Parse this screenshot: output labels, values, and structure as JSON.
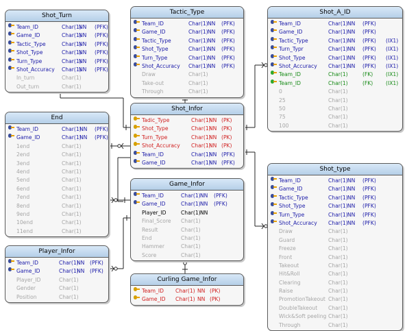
{
  "entities": [
    {
      "id": "shot-turn",
      "title": "Shot_Turn",
      "attrs": [
        {
          "name": "Team_ID",
          "type": "Char(1)",
          "nn": "NN",
          "key": "(PFK)",
          "style": "pk",
          "icon": true
        },
        {
          "name": "Game_ID",
          "type": "Char(1)",
          "nn": "NN",
          "key": "(PFK)",
          "style": "pk",
          "icon": true
        },
        {
          "name": "Tactic_Type",
          "type": "Char(1)",
          "nn": "NN",
          "key": "(PFK)",
          "style": "pk",
          "icon": true
        },
        {
          "name": "Shot_Type",
          "type": "Char(1)",
          "nn": "NN",
          "key": "(PFK)",
          "style": "pk",
          "icon": true
        },
        {
          "name": "Turn_Type",
          "type": "Char(1)",
          "nn": "NN",
          "key": "(PFK)",
          "style": "pk",
          "icon": true
        },
        {
          "name": "Shot_Accuracy",
          "type": "Char(1)",
          "nn": "NN",
          "key": "(PFK)",
          "style": "pk",
          "icon": true
        },
        {
          "name": "In_turn",
          "type": "Char(1)",
          "nn": "",
          "key": "",
          "style": "gray",
          "icon": false
        },
        {
          "name": "Out_turn",
          "type": "Char(1)",
          "nn": "",
          "key": "",
          "style": "gray",
          "icon": false
        }
      ]
    },
    {
      "id": "tactic-type",
      "title": "Tactic_Type",
      "attrs": [
        {
          "name": "Team_ID",
          "type": "Char(1)",
          "nn": "NN",
          "key": "(PFK)",
          "style": "pk",
          "icon": true
        },
        {
          "name": "Game_ID",
          "type": "Char(1)",
          "nn": "NN",
          "key": "(PFK)",
          "style": "pk",
          "icon": true
        },
        {
          "name": "Tactic_Type",
          "type": "Char(1)",
          "nn": "NN",
          "key": "(PFK)",
          "style": "pk",
          "icon": true
        },
        {
          "name": "Shot_Type",
          "type": "Char(1)",
          "nn": "NN",
          "key": "(PFK)",
          "style": "pk",
          "icon": true
        },
        {
          "name": "Turn_Type",
          "type": "Char(1)",
          "nn": "NN",
          "key": "(PFK)",
          "style": "pk",
          "icon": true
        },
        {
          "name": "Shot_Accuracy",
          "type": "Char(1)",
          "nn": "NN",
          "key": "(PFK)",
          "style": "pk",
          "icon": true
        },
        {
          "name": "Draw",
          "type": "Char(1)",
          "nn": "",
          "key": "",
          "style": "gray",
          "icon": false
        },
        {
          "name": "Take-out",
          "type": "Char(1)",
          "nn": "",
          "key": "",
          "style": "gray",
          "icon": false
        },
        {
          "name": "Through",
          "type": "Char(1)",
          "nn": "",
          "key": "",
          "style": "gray",
          "icon": false
        }
      ]
    },
    {
      "id": "shot-a-id",
      "title": "Shot_A_ID",
      "attrs": [
        {
          "name": "Team_ID",
          "type": "Char(1)",
          "nn": "NN",
          "key": "(PFK)",
          "ix": "",
          "style": "pk",
          "icon": true
        },
        {
          "name": "Game_ID",
          "type": "Char(1)",
          "nn": "NN",
          "key": "(PFK)",
          "ix": "",
          "style": "pk",
          "icon": true
        },
        {
          "name": "Tactic_Type",
          "type": "Char(1)",
          "nn": "NN",
          "key": "(PFK)",
          "ix": "(IX1)",
          "style": "pk",
          "icon": true
        },
        {
          "name": "Turn_Typr",
          "type": "Char(1)",
          "nn": "NN",
          "key": "(PFK)",
          "ix": "(IX1)",
          "style": "pk",
          "icon": true
        },
        {
          "name": "Shot_Type",
          "type": "Char(1)",
          "nn": "NN",
          "key": "(PFK)",
          "ix": "(IX1)",
          "style": "pk",
          "icon": true
        },
        {
          "name": "Shot_Accuracy",
          "type": "Char(1)",
          "nn": "NN",
          "key": "(PFK)",
          "ix": "(IX1)",
          "style": "pk",
          "icon": true
        },
        {
          "name": "Team_ID",
          "type": "Char(1)",
          "nn": "",
          "key": "(FK)",
          "ix": "(IX1)",
          "style": "green",
          "icon": true
        },
        {
          "name": "Team_ID",
          "type": "Char(1)",
          "nn": "",
          "key": "(FK)",
          "ix": "(IX1)",
          "style": "green",
          "icon": true
        },
        {
          "name": "0",
          "type": "Char(1)",
          "nn": "",
          "key": "",
          "ix": "",
          "style": "gray",
          "icon": false
        },
        {
          "name": "25",
          "type": "Char(1)",
          "nn": "",
          "key": "",
          "ix": "",
          "style": "gray",
          "icon": false
        },
        {
          "name": "50",
          "type": "Char(1)",
          "nn": "",
          "key": "",
          "ix": "",
          "style": "gray",
          "icon": false
        },
        {
          "name": "75",
          "type": "Char(1)",
          "nn": "",
          "key": "",
          "ix": "",
          "style": "gray",
          "icon": false
        },
        {
          "name": "100",
          "type": "Char(1)",
          "nn": "",
          "key": "",
          "ix": "",
          "style": "gray",
          "icon": false
        }
      ]
    },
    {
      "id": "end",
      "title": "End",
      "attrs": [
        {
          "name": "Team_ID",
          "type": "Char(1)",
          "nn": "NN",
          "key": "(PFK)",
          "style": "pk",
          "icon": true
        },
        {
          "name": "Game_ID",
          "type": "Char(1)",
          "nn": "NN",
          "key": "(PFK)",
          "style": "pk",
          "icon": true
        },
        {
          "name": "1end",
          "type": "Char(1)",
          "nn": "",
          "key": "",
          "style": "gray",
          "icon": false
        },
        {
          "name": "2end",
          "type": "Char(1)",
          "nn": "",
          "key": "",
          "style": "gray",
          "icon": false
        },
        {
          "name": "3end",
          "type": "Char(1)",
          "nn": "",
          "key": "",
          "style": "gray",
          "icon": false
        },
        {
          "name": "4end",
          "type": "Char(1)",
          "nn": "",
          "key": "",
          "style": "gray",
          "icon": false
        },
        {
          "name": "5end",
          "type": "Char(1)",
          "nn": "",
          "key": "",
          "style": "gray",
          "icon": false
        },
        {
          "name": "6end",
          "type": "Char(1)",
          "nn": "",
          "key": "",
          "style": "gray",
          "icon": false
        },
        {
          "name": "7end",
          "type": "Char(1)",
          "nn": "",
          "key": "",
          "style": "gray",
          "icon": false
        },
        {
          "name": "8end",
          "type": "Char(1)",
          "nn": "",
          "key": "",
          "style": "gray",
          "icon": false
        },
        {
          "name": "9end",
          "type": "Char(1)",
          "nn": "",
          "key": "",
          "style": "gray",
          "icon": false
        },
        {
          "name": "10end",
          "type": "Char(1)",
          "nn": "",
          "key": "",
          "style": "gray",
          "icon": false
        },
        {
          "name": "11end",
          "type": "Char(1)",
          "nn": "",
          "key": "",
          "style": "gray",
          "icon": false
        }
      ]
    },
    {
      "id": "shot-infor",
      "title": "Shot_Infor",
      "attrs": [
        {
          "name": "Tadic_Type",
          "type": "Char(1)",
          "nn": "NN",
          "key": "(PK)",
          "style": "red",
          "icon": true
        },
        {
          "name": "Shot_Type",
          "type": "Char(1)",
          "nn": "NN",
          "key": "(PK)",
          "style": "red",
          "icon": true
        },
        {
          "name": "Turn_Type",
          "type": "Char(1)",
          "nn": "NN",
          "key": "(PK)",
          "style": "red",
          "icon": true
        },
        {
          "name": "Shot_Accuracy",
          "type": "Char(1)",
          "nn": "NN",
          "key": "(PK)",
          "style": "red",
          "icon": true
        },
        {
          "name": "Team_ID",
          "type": "Char(1)",
          "nn": "NN",
          "key": "(PFK)",
          "style": "pk",
          "icon": true
        },
        {
          "name": "Game_ID",
          "type": "Char(1)",
          "nn": "NN",
          "key": "(PFK)",
          "style": "pk",
          "icon": true
        }
      ]
    },
    {
      "id": "shot-type",
      "title": "Shot_type",
      "attrs": [
        {
          "name": "Team_ID",
          "type": "Char(1)",
          "nn": "NN",
          "key": "(PFK)",
          "style": "pk",
          "icon": true
        },
        {
          "name": "Game_ID",
          "type": "Char(1)",
          "nn": "NN",
          "key": "(PFK)",
          "style": "pk",
          "icon": true
        },
        {
          "name": "Tactic_Type",
          "type": "Char(1)",
          "nn": "NN",
          "key": "(PFK)",
          "style": "pk",
          "icon": true
        },
        {
          "name": "Shot_Type",
          "type": "Char(1)",
          "nn": "NN",
          "key": "(PFK)",
          "style": "pk",
          "icon": true
        },
        {
          "name": "Turn_Type",
          "type": "Char(1)",
          "nn": "NN",
          "key": "(PFK)",
          "style": "pk",
          "icon": true
        },
        {
          "name": "Shot_Accuracy",
          "type": "Char(1)",
          "nn": "NN",
          "key": "(PFK)",
          "style": "pk",
          "icon": true
        },
        {
          "name": "Draw",
          "type": "Char(1)",
          "nn": "",
          "key": "",
          "style": "gray",
          "icon": false
        },
        {
          "name": "Guard",
          "type": "Char(1)",
          "nn": "",
          "key": "",
          "style": "gray",
          "icon": false
        },
        {
          "name": "Freeze",
          "type": "Char(1)",
          "nn": "",
          "key": "",
          "style": "gray",
          "icon": false
        },
        {
          "name": "Front",
          "type": "Char(1)",
          "nn": "",
          "key": "",
          "style": "gray",
          "icon": false
        },
        {
          "name": "Takeout",
          "type": "Char(1)",
          "nn": "",
          "key": "",
          "style": "gray",
          "icon": false
        },
        {
          "name": "Hit&Roll",
          "type": "Char(1)",
          "nn": "",
          "key": "",
          "style": "gray",
          "icon": false
        },
        {
          "name": "Clearing",
          "type": "Char(1)",
          "nn": "",
          "key": "",
          "style": "gray",
          "icon": false
        },
        {
          "name": "Raise",
          "type": "Char(1)",
          "nn": "",
          "key": "",
          "style": "gray",
          "icon": false
        },
        {
          "name": "PromotionTakeout",
          "type": "Char(1)",
          "nn": "",
          "key": "",
          "style": "gray",
          "icon": false
        },
        {
          "name": "DoubleTakeout",
          "type": "Char(1)",
          "nn": "",
          "key": "",
          "style": "gray",
          "icon": false
        },
        {
          "name": "Wick&Soft peeling",
          "type": "Char(1)",
          "nn": "",
          "key": "",
          "style": "gray",
          "icon": false
        },
        {
          "name": "Through",
          "type": "Char(1)",
          "nn": "",
          "key": "",
          "style": "gray",
          "icon": false
        }
      ]
    },
    {
      "id": "game-infor",
      "title": "Game_Infor",
      "attrs": [
        {
          "name": "Team_ID",
          "type": "Char(1)",
          "nn": "NN",
          "key": "(PFK)",
          "style": "pk",
          "icon": true
        },
        {
          "name": "Game_ID",
          "type": "Char(1)",
          "nn": "NN",
          "key": "(PFK)",
          "style": "pk",
          "icon": true
        },
        {
          "name": "Player_ID",
          "type": "Char(1)",
          "nn": "NN",
          "key": "",
          "style": "black",
          "icon": false
        },
        {
          "name": "Final_Score",
          "type": "Char(1)",
          "nn": "",
          "key": "",
          "style": "gray",
          "icon": false
        },
        {
          "name": "Result",
          "type": "Char(1)",
          "nn": "",
          "key": "",
          "style": "gray",
          "icon": false
        },
        {
          "name": "End",
          "type": "Char(1)",
          "nn": "",
          "key": "",
          "style": "gray",
          "icon": false
        },
        {
          "name": "Hammer",
          "type": "Char(1)",
          "nn": "",
          "key": "",
          "style": "gray",
          "icon": false
        },
        {
          "name": "Score",
          "type": "Char(1)",
          "nn": "",
          "key": "",
          "style": "gray",
          "icon": false
        }
      ]
    },
    {
      "id": "player-infor",
      "title": "Player_Infor",
      "attrs": [
        {
          "name": "Team_ID",
          "type": "Char(1)",
          "nn": "NN",
          "key": "(PFK)",
          "style": "pk",
          "icon": true
        },
        {
          "name": "Game_ID",
          "type": "Char(1)",
          "nn": "NN",
          "key": "(PFK)",
          "style": "pk",
          "icon": true
        },
        {
          "name": "Player_ID",
          "type": "Char(1)",
          "nn": "",
          "key": "",
          "style": "gray",
          "icon": false
        },
        {
          "name": "Gender",
          "type": "Char(1)",
          "nn": "",
          "key": "",
          "style": "gray",
          "icon": false
        },
        {
          "name": "Position",
          "type": "Char(1)",
          "nn": "",
          "key": "",
          "style": "gray",
          "icon": false
        }
      ]
    },
    {
      "id": "curling-game-infor",
      "title": "Curling Game_Infor",
      "attrs": [
        {
          "name": "Team_ID",
          "type": "Char(1)",
          "nn": "NN",
          "key": "(PK)",
          "style": "red",
          "icon": true
        },
        {
          "name": "Game_ID",
          "type": "Char(1)",
          "nn": "NN",
          "key": "(PK)",
          "style": "red",
          "icon": true
        }
      ]
    }
  ]
}
